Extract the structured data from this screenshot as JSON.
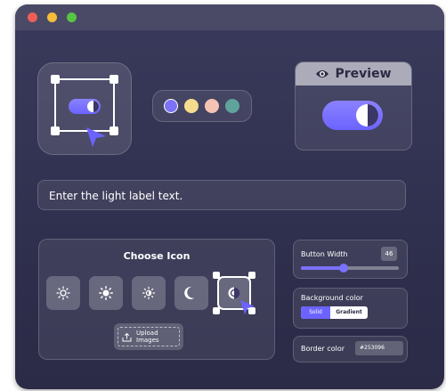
{
  "window": {
    "controls": [
      "close",
      "minimize",
      "maximize"
    ]
  },
  "colors": {
    "accent": "#6c63ff",
    "swatches": [
      "#7b72f5",
      "#f6dc8e",
      "#f5c3b4",
      "#5fa49c"
    ]
  },
  "preview": {
    "title": "Preview",
    "icon": "eye-icon"
  },
  "label_input": {
    "placeholder": "Enter the light label text."
  },
  "choose_icon": {
    "title": "Choose Icon",
    "options": [
      "sun-outline-icon",
      "sun-filled-icon",
      "sun-small-icon",
      "moon-icon",
      "contrast-icon"
    ],
    "selected": "contrast-icon",
    "upload_label": "Upload Images"
  },
  "button_width": {
    "label": "Button Width",
    "value": "46",
    "slider_fraction": 0.44
  },
  "background_color": {
    "label": "Background color",
    "options": [
      "Solid",
      "Gradient"
    ],
    "selected": "Solid"
  },
  "border_color": {
    "label": "Border color",
    "value": "#253096"
  }
}
